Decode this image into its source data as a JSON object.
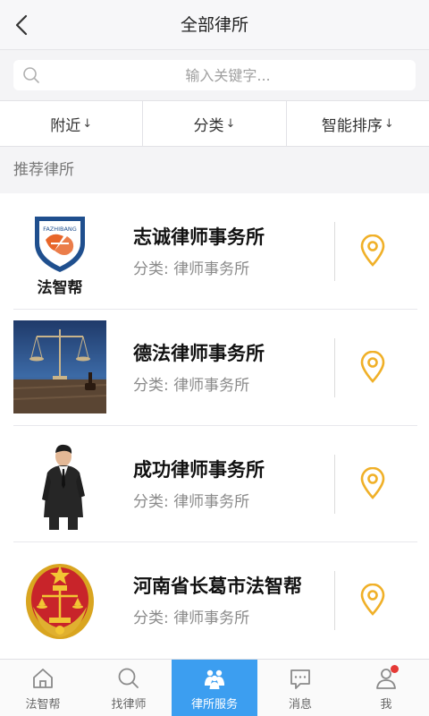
{
  "header": {
    "title": "全部律所"
  },
  "search": {
    "placeholder": "输入关键字..."
  },
  "filters": [
    {
      "label": "附近",
      "arrow": "↓"
    },
    {
      "label": "分类",
      "arrow": "↓"
    },
    {
      "label": "智能排序",
      "arrow": "↓"
    }
  ],
  "section": {
    "title": "推荐律所"
  },
  "firms": [
    {
      "name": "志诚律师事务所",
      "category": "分类: 律师事务所",
      "thumb": "fazhibang-logo",
      "logo_text": "法智帮",
      "logo_subtext": "FAZHIBANG"
    },
    {
      "name": "德法律师事务所",
      "category": "分类: 律师事务所",
      "thumb": "justice-scales-photo"
    },
    {
      "name": "成功律师事务所",
      "category": "分类: 律师事务所",
      "thumb": "lawyer-portrait"
    },
    {
      "name": "河南省长葛市法智帮",
      "category": "分类: 律师事务所",
      "thumb": "court-emblem"
    }
  ],
  "tabs": [
    {
      "label": "法智帮",
      "icon": "home-icon",
      "active": false
    },
    {
      "label": "找律师",
      "icon": "search-icon",
      "active": false
    },
    {
      "label": "律所服务",
      "icon": "people-icon",
      "active": true
    },
    {
      "label": "消息",
      "icon": "message-icon",
      "active": false
    },
    {
      "label": "我",
      "icon": "user-icon",
      "active": false,
      "badge": true
    }
  ],
  "colors": {
    "accent": "#3c9ef0",
    "location": "#f0b028",
    "badge": "#e53935"
  }
}
